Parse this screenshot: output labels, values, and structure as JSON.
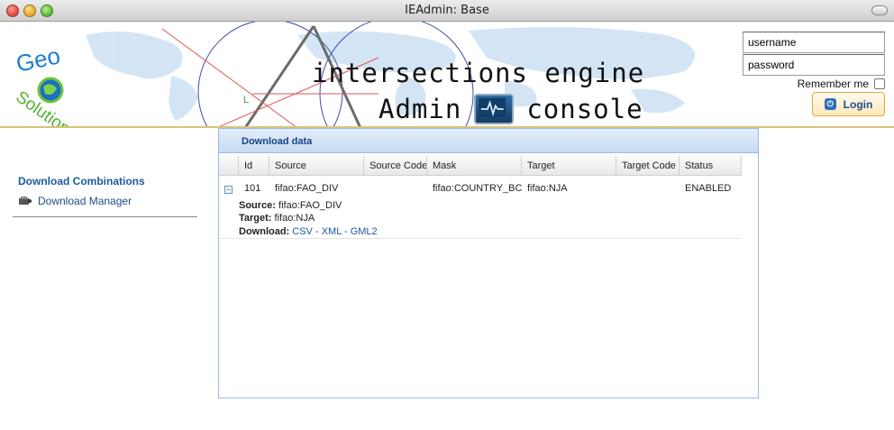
{
  "window": {
    "title": "IEAdmin: Base"
  },
  "header": {
    "logo_text": [
      "Geo",
      "Solutions"
    ],
    "line1": "intersections engine",
    "line2_left": "Admin",
    "line2_right": "console"
  },
  "login": {
    "username_value": "username",
    "password_value": "password",
    "remember_label": "Remember me",
    "button_label": "Login"
  },
  "nav": {
    "title": "Download Combinations",
    "item_label": "Download Manager"
  },
  "panel": {
    "title": "Download data",
    "columns": [
      "Id",
      "Source",
      "Source Code",
      "Mask",
      "Target",
      "Target Code",
      "Status"
    ],
    "row": {
      "id": "101",
      "source": "fifao:FAO_DIV",
      "source_code": "",
      "mask": "fifao:COUNTRY_BC",
      "target": "fifao:NJA",
      "target_code": "",
      "status": "ENABLED"
    },
    "detail": {
      "source_label": "Source:",
      "source_value": "fifao:FAO_DIV",
      "target_label": "Target:",
      "target_value": "fifao:NJA",
      "download_label": "Download:",
      "formats": [
        "CSV",
        "XML",
        "GML2"
      ],
      "separator": " - "
    }
  },
  "colors": {
    "link": "#1f5aa0",
    "panel_header_text": "#15428b",
    "accent_border": "#d9c27a"
  }
}
